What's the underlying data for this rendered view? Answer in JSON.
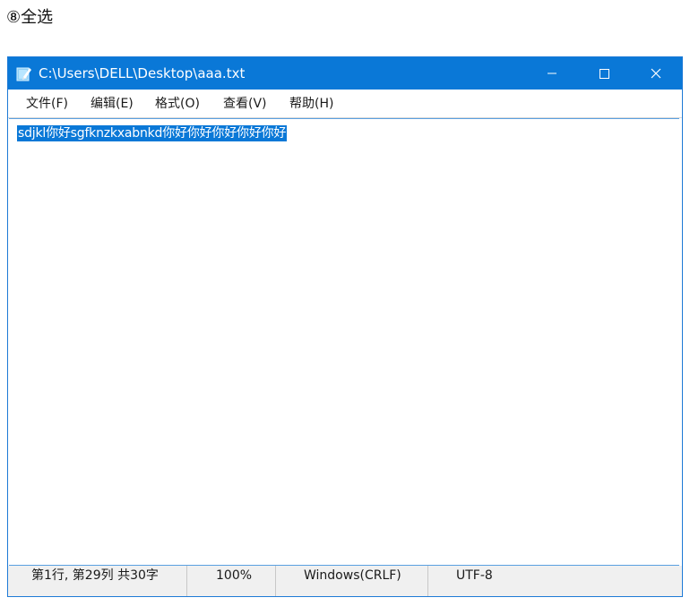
{
  "caption": "⑧全选",
  "window": {
    "title": "C:\\Users\\DELL\\Desktop\\aaa.txt",
    "app_icon": "notepad-icon",
    "controls": {
      "minimize_icon": "minimize-icon",
      "maximize_icon": "maximize-icon",
      "close_icon": "close-icon"
    }
  },
  "menu": {
    "items": [
      {
        "label": "文件(F)"
      },
      {
        "label": "编辑(E)"
      },
      {
        "label": "格式(O)"
      },
      {
        "label": "查看(V)"
      },
      {
        "label": "帮助(H)"
      }
    ]
  },
  "editor": {
    "content": "sdjkl你好sgfknzkxabnkd你好你好你好你好你好",
    "selected": true
  },
  "status": {
    "position": "第1行, 第29列 共30字",
    "zoom": "100%",
    "line_ending": "Windows(CRLF)",
    "encoding": "UTF-8"
  },
  "colors": {
    "titlebar": "#0a78d7",
    "selection": "#0a78d7",
    "statusbar": "#f0f0f0"
  }
}
